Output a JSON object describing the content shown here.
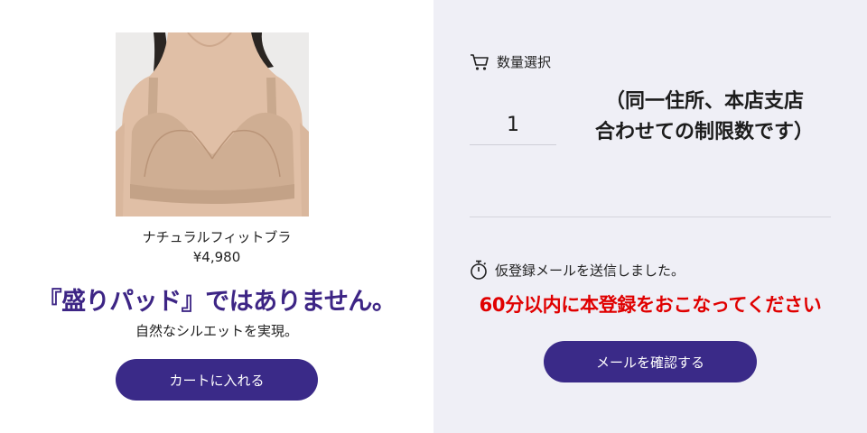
{
  "product": {
    "name": "ナチュラルフィットブラ",
    "price": "¥4,980",
    "headline": "『盛りパッド』ではありません。",
    "subline": "自然なシルエットを実現。",
    "cart_button_label": "カートに入れる"
  },
  "quantity": {
    "header_label": "数量選択",
    "header_icon": "cart-icon",
    "value": "1",
    "note_line1": "（同一住所、本店支店",
    "note_line2": "合わせての制限数です）"
  },
  "registration": {
    "icon": "stopwatch-icon",
    "message": "仮登録メールを送信しました。",
    "alert": "60分以内に本登録をおこなってください",
    "confirm_button_label": "メールを確認する"
  },
  "colors": {
    "button_bg": "#3a2a88",
    "headline": "#3d2585",
    "alert": "#e00000",
    "right_panel_bg": "#efeff6"
  }
}
